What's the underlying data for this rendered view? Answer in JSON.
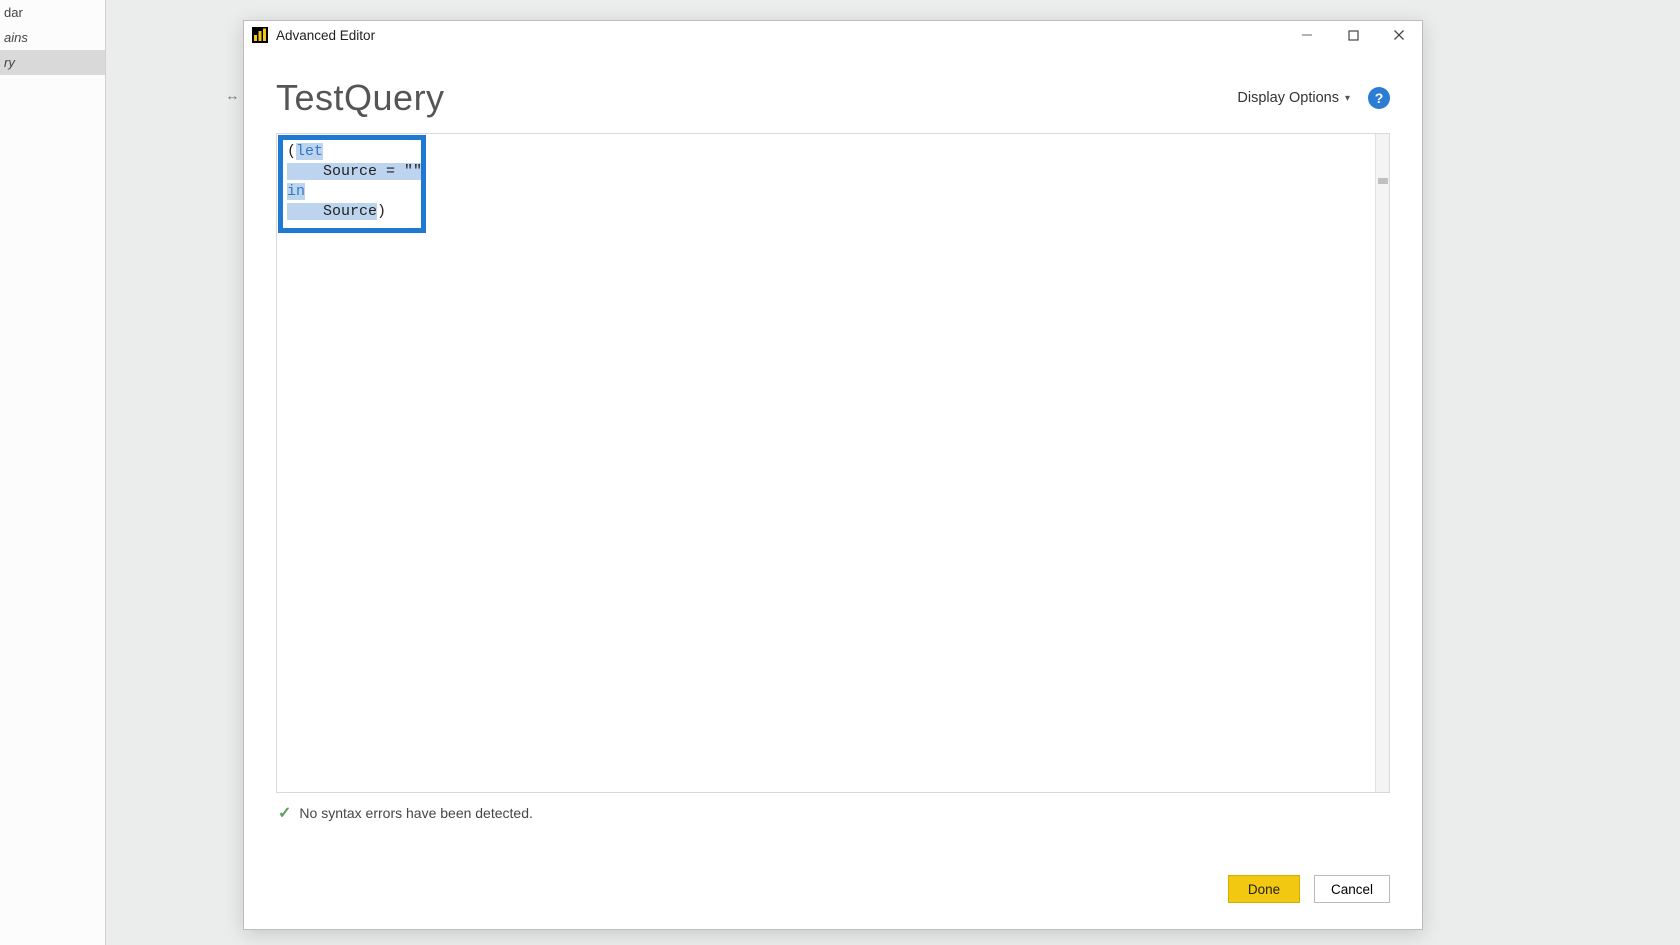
{
  "sidebar": {
    "items": [
      {
        "label": "dar",
        "italic": false,
        "selected": false
      },
      {
        "label": "ains",
        "italic": true,
        "selected": false
      },
      {
        "label": "ry",
        "italic": true,
        "selected": true
      }
    ]
  },
  "window": {
    "title": "Advanced Editor"
  },
  "header": {
    "query_title": "TestQuery",
    "display_options_label": "Display Options"
  },
  "code": {
    "line1_paren": "(",
    "line1_kw": "let",
    "line2_text": "    Source = \"\"",
    "line3_kw": "in",
    "line4_text": "    Source",
    "line4_paren": ")"
  },
  "status": {
    "message": "No syntax errors have been detected."
  },
  "buttons": {
    "done": "Done",
    "cancel": "Cancel"
  }
}
